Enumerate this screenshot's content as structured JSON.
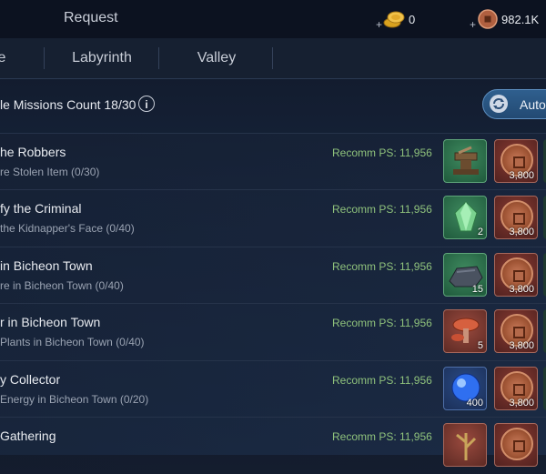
{
  "top": {
    "title": "Request",
    "gold": {
      "icon": "gold-coins-icon",
      "amount": "0"
    },
    "copper": {
      "icon": "copper-coin-icon",
      "amount": "982.1K"
    },
    "plus": "+"
  },
  "tabs": [
    {
      "label": "e"
    },
    {
      "label": "Labyrinth"
    },
    {
      "label": "Valley"
    }
  ],
  "missions_header": {
    "text": "le Missions Count 18/30",
    "info": "i",
    "auto_label": "Auto"
  },
  "missions": [
    {
      "title": "he Robbers",
      "subtitle": "re Stolen Item (0/30)",
      "recomm": "Recomm PS: 11,956",
      "reward": {
        "icon": "anvil-icon",
        "style": "green",
        "qty": ""
      },
      "coin_qty": "3,800"
    },
    {
      "title": "fy the Criminal",
      "subtitle": "the Kidnapper's Face (0/40)",
      "recomm": "Recomm PS: 11,956",
      "reward": {
        "icon": "green-gem-icon",
        "style": "green",
        "qty": "2"
      },
      "coin_qty": "3,800"
    },
    {
      "title": "in Bicheon Town",
      "subtitle": "re in Bicheon Town (0/40)",
      "recomm": "Recomm PS: 11,956",
      "reward": {
        "icon": "ore-icon",
        "style": "green",
        "qty": "15"
      },
      "coin_qty": "3,800"
    },
    {
      "title": "r in Bicheon Town",
      "subtitle": "Plants in Bicheon Town (0/40)",
      "recomm": "Recomm PS: 11,956",
      "reward": {
        "icon": "mushroom-icon",
        "style": "red",
        "qty": "5"
      },
      "coin_qty": "3,800"
    },
    {
      "title": "y Collector",
      "subtitle": "Energy in Bicheon Town (0/20)",
      "recomm": "Recomm PS: 11,956",
      "reward": {
        "icon": "blue-orb-icon",
        "style": "blue",
        "qty": "400"
      },
      "coin_qty": "3,800"
    },
    {
      "title": "Gathering",
      "subtitle": "",
      "recomm": "Recomm PS: 11,956",
      "reward": {
        "icon": "herb-icon",
        "style": "red",
        "qty": ""
      },
      "coin_qty": ""
    }
  ]
}
